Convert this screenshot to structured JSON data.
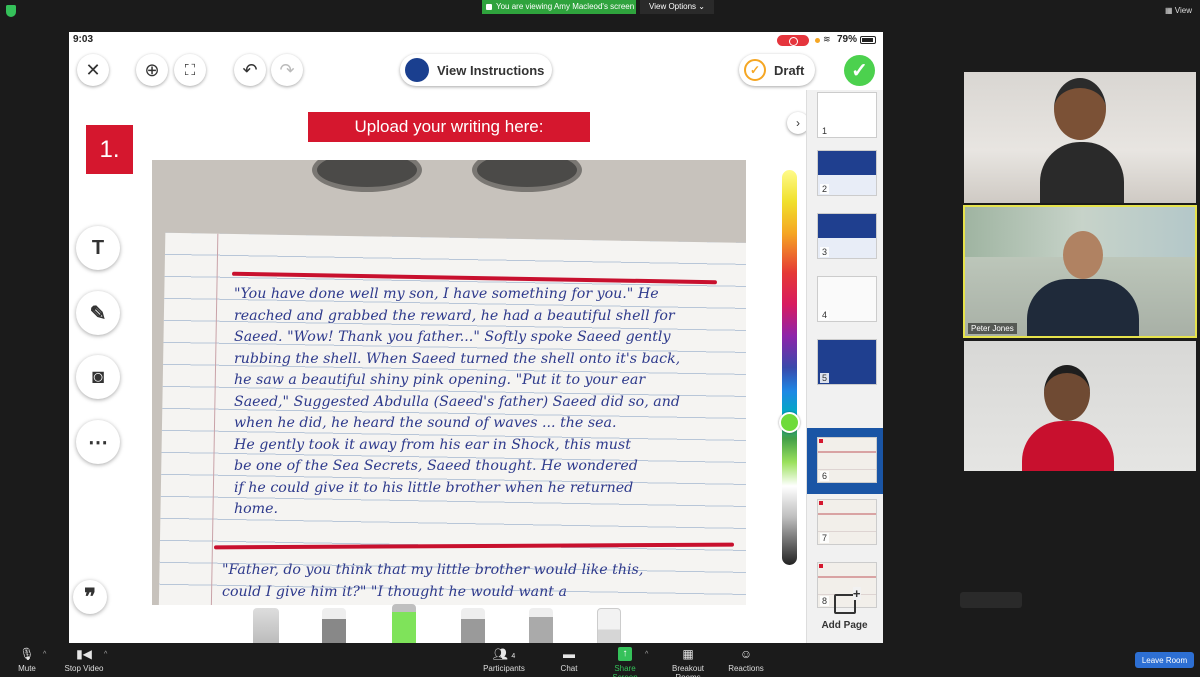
{
  "zoom_top": {
    "viewing_banner": "You are viewing Amy Macleod's screen",
    "view_options": "View Options ⌄",
    "view": "View"
  },
  "tablet": {
    "status": {
      "time": "9:03",
      "battery": "79%"
    },
    "toolbar": {
      "view_instructions": "View Instructions",
      "draft": "Draft"
    },
    "question_number": "1.",
    "upload_banner": "Upload your writing here:",
    "handwriting_lines": [
      "\"You have done well my son, I have something for you.\" He",
      "reached and grabbed the reward, he had a beautiful shell for",
      "Saeed. \"Wow! Thank you father...\" Softly spoke Saeed gently",
      "rubbing the shell. When Saeed turned the shell onto it's back,",
      "he saw a beautiful shiny pink opening. \"Put it to your ear",
      "Saeed,\" Suggested Abdulla (Saeed's father) Saeed did so, and",
      "when he did, he heard the sound of waves ... the sea.",
      "He gently took it away from his ear in Shock, this must",
      "be one of the Sea Secrets, Saeed thought. He wondered",
      "if he could give it to his little brother when he returned",
      "home."
    ],
    "handwriting_lines_2": [
      "\"Father, do you think that my little brother would like this,",
      "could I give him it?\" \"I thought he would want a"
    ],
    "slides": [
      "1",
      "2",
      "3",
      "4",
      "5",
      "6",
      "7",
      "8"
    ],
    "active_slide": 6,
    "add_page": "Add Page"
  },
  "participants": [
    {
      "name": ""
    },
    {
      "name": "Peter Jones"
    },
    {
      "name": ""
    }
  ],
  "zoom_bottom": {
    "mute": "Mute",
    "stop_video": "Stop Video",
    "participants": "Participants",
    "participants_count": "4",
    "chat": "Chat",
    "share_screen": "Share Screen",
    "breakout_rooms": "Breakout Rooms",
    "reactions": "Reactions",
    "leave": "Leave Room"
  },
  "colors": {
    "zoom_bg": "#1b1b1b",
    "share_green": "#2fa33d",
    "accent_red": "#d5172e",
    "done_green": "#4cd14e",
    "leave_blue": "#2d6fd3",
    "active_slide": "#1a55a5"
  }
}
